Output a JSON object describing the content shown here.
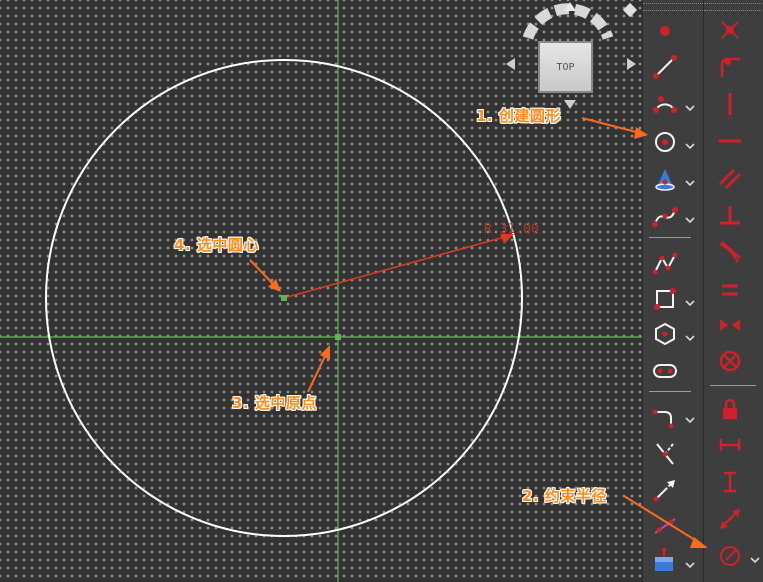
{
  "callouts": {
    "step1": "1. 创建圆形",
    "step2": "2. 约束半径",
    "step3": "3. 选中原点",
    "step4": "4. 选中圆心"
  },
  "nav_cube": {
    "face_label": "TOP"
  },
  "dimension": {
    "label": "R 31.00"
  },
  "colors": {
    "callout": "#ff8a1a",
    "arrow": "#ff6a1a",
    "icon_red": "#d0202a",
    "axis_green": "#5ab84c",
    "circle": "#ffffff"
  },
  "toolbar_left": [
    {
      "name": "create-point-icon",
      "dropdown": false
    },
    {
      "name": "create-line-icon",
      "dropdown": false
    },
    {
      "name": "create-arc-icon",
      "dropdown": true
    },
    {
      "name": "create-circle-icon",
      "dropdown": true
    },
    {
      "name": "create-conic-icon",
      "dropdown": true
    },
    {
      "name": "create-bspline-icon",
      "dropdown": true
    },
    {
      "name": "create-polyline-icon",
      "dropdown": false
    },
    {
      "name": "create-rectangle-icon",
      "dropdown": true
    },
    {
      "name": "create-polygon-icon",
      "dropdown": true
    },
    {
      "name": "create-slot-icon",
      "dropdown": false
    },
    {
      "name": "create-fillet-icon",
      "dropdown": true
    },
    {
      "name": "trim-edge-icon",
      "dropdown": false
    },
    {
      "name": "extend-edge-icon",
      "dropdown": false
    },
    {
      "name": "external-geometry-icon",
      "dropdown": false
    },
    {
      "name": "carbon-copy-icon",
      "dropdown": true
    }
  ],
  "toolbar_right": [
    {
      "name": "constrain-coincident-icon"
    },
    {
      "name": "constrain-point-on-object-icon"
    },
    {
      "name": "constrain-vertical-icon"
    },
    {
      "name": "constrain-horizontal-icon"
    },
    {
      "name": "constrain-parallel-icon"
    },
    {
      "name": "constrain-perpendicular-icon"
    },
    {
      "name": "constrain-tangent-icon"
    },
    {
      "name": "constrain-equal-icon"
    },
    {
      "name": "constrain-symmetric-icon"
    },
    {
      "name": "constrain-block-icon"
    },
    {
      "name": "constrain-lock-icon"
    },
    {
      "name": "constrain-horizontal-distance-icon"
    },
    {
      "name": "constrain-vertical-distance-icon"
    },
    {
      "name": "constrain-distance-icon"
    },
    {
      "name": "constrain-radius-icon",
      "dropdown": true
    }
  ]
}
